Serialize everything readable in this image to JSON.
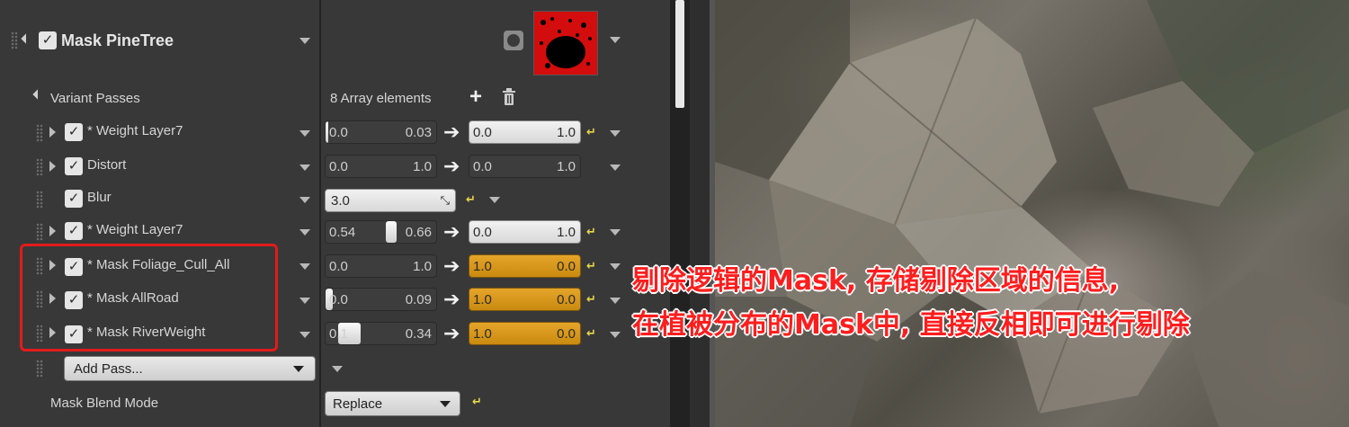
{
  "header": {
    "title": "Mask PineTree",
    "enabled": true
  },
  "variant_passes": {
    "label": "Variant Passes",
    "array_count": "8 Array elements",
    "add_icon": "plus-icon",
    "delete_icon": "trash-icon",
    "rows": [
      {
        "label": "* Weight Layer7",
        "expandable": true,
        "min": "0.0",
        "max": "0.03",
        "min_fraction": 0.0,
        "max_fraction": 0.03,
        "out_min": "0.0",
        "out_max": "1.0",
        "out_style": "light"
      },
      {
        "label": "Distort",
        "expandable": true,
        "min": "0.0",
        "max": "1.0",
        "min_fraction": 0.0,
        "max_fraction": 1.0,
        "out_min": "0.0",
        "out_max": "1.0",
        "out_style": "light"
      },
      {
        "label": "Blur",
        "expandable": false,
        "value": "3.0"
      },
      {
        "label": "* Weight Layer7",
        "expandable": true,
        "min": "0.54",
        "max": "0.66",
        "min_fraction": 0.54,
        "max_fraction": 0.66,
        "out_min": "0.0",
        "out_max": "1.0",
        "out_style": "light"
      },
      {
        "label": "* Mask Foliage_Cull_All",
        "expandable": true,
        "min": "0.0",
        "max": "1.0",
        "min_fraction": 0.0,
        "max_fraction": 1.0,
        "out_min": "1.0",
        "out_max": "0.0",
        "out_style": "gold"
      },
      {
        "label": "* Mask AllRoad",
        "expandable": true,
        "min": "0.0",
        "max": "0.09",
        "min_fraction": 0.0,
        "max_fraction": 0.09,
        "out_min": "1.0",
        "out_max": "0.0",
        "out_style": "gold"
      },
      {
        "label": "* Mask RiverWeight",
        "expandable": true,
        "min": "0.1",
        "max": "0.34",
        "min_fraction": 0.1,
        "max_fraction": 0.34,
        "out_min": "1.0",
        "out_max": "0.0",
        "out_style": "gold"
      }
    ],
    "add_pass_label": "Add Pass..."
  },
  "blend_mode": {
    "label": "Mask Blend Mode",
    "value": "Replace"
  },
  "annotation": {
    "line1": "剔除逻辑的Mask, 存储剔除区域的信息,",
    "line2": "在植被分布的Mask中, 直接反相即可进行剔除"
  },
  "colors": {
    "accent_gold": "#d9961a",
    "highlight_red": "#e21b1b",
    "thumbnail_red": "#e01010"
  }
}
